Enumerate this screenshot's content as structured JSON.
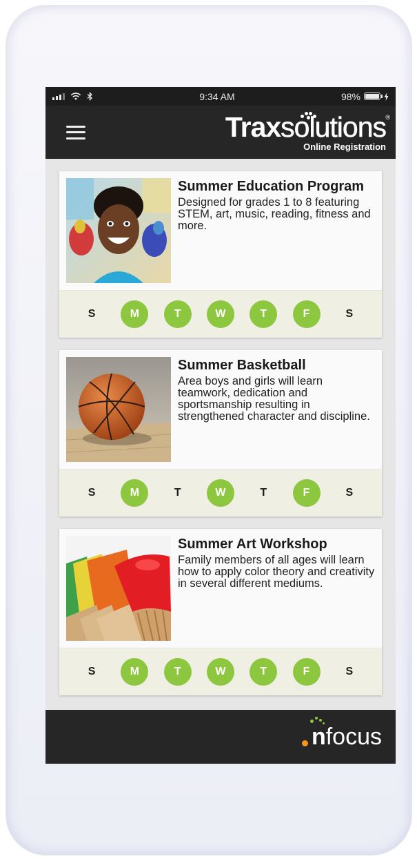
{
  "status_bar": {
    "time": "9:34 AM",
    "battery": "98%"
  },
  "header": {
    "logo_bold": "Trax",
    "logo_light": "solutions",
    "logo_reg": "®",
    "logo_sub": "Online Registration",
    "menu_icon": "hamburger-menu-icon"
  },
  "programs": [
    {
      "title": "Summer Education Program",
      "description": "Designed for grades 1 to 8 featuring STEM, art, music, reading, fitness and more.",
      "days": [
        {
          "label": "S",
          "active": false
        },
        {
          "label": "M",
          "active": true
        },
        {
          "label": "T",
          "active": true
        },
        {
          "label": "W",
          "active": true
        },
        {
          "label": "T",
          "active": true
        },
        {
          "label": "F",
          "active": true
        },
        {
          "label": "S",
          "active": false
        }
      ]
    },
    {
      "title": "Summer Basketball",
      "description": "Area boys and girls will learn teamwork, dedication and sportsmanship resulting in strengthened character and discipline.",
      "days": [
        {
          "label": "S",
          "active": false
        },
        {
          "label": "M",
          "active": true
        },
        {
          "label": "T",
          "active": false
        },
        {
          "label": "W",
          "active": true
        },
        {
          "label": "T",
          "active": false
        },
        {
          "label": "F",
          "active": true
        },
        {
          "label": "S",
          "active": false
        }
      ]
    },
    {
      "title": "Summer Art Workshop",
      "description": "Family members of all ages will learn how to apply color theory and creativity in several different mediums.",
      "days": [
        {
          "label": "S",
          "active": false
        },
        {
          "label": "M",
          "active": true
        },
        {
          "label": "T",
          "active": true
        },
        {
          "label": "W",
          "active": true
        },
        {
          "label": "T",
          "active": true
        },
        {
          "label": "F",
          "active": true
        },
        {
          "label": "S",
          "active": false
        }
      ]
    }
  ],
  "footer": {
    "brand_n": "n",
    "brand_rest": "focus"
  },
  "colors": {
    "active_day": "#8dc63f",
    "header_bg": "#262626",
    "day_strip_bg": "#efefe3"
  }
}
